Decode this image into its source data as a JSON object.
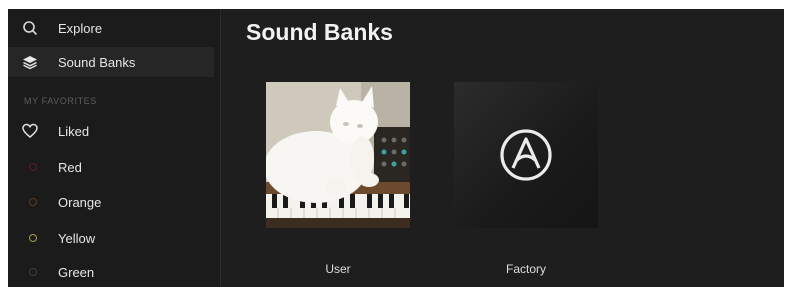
{
  "sidebar": {
    "items": [
      {
        "label": "Explore",
        "icon": "search-icon"
      },
      {
        "label": "Sound Banks",
        "icon": "layers-icon",
        "active": true
      }
    ],
    "favorites_title": "MY FAVORITES",
    "favorites": [
      {
        "label": "Liked",
        "icon": "heart-icon"
      },
      {
        "label": "Red",
        "color": "#5a1e1e"
      },
      {
        "label": "Orange",
        "color": "#5a3a1a"
      },
      {
        "label": "Yellow",
        "color": "#a89a4a"
      },
      {
        "label": "Green",
        "color": "#2f4a2a"
      }
    ]
  },
  "main": {
    "title": "Sound Banks",
    "banks": [
      {
        "label": "User"
      },
      {
        "label": "Factory"
      }
    ]
  }
}
